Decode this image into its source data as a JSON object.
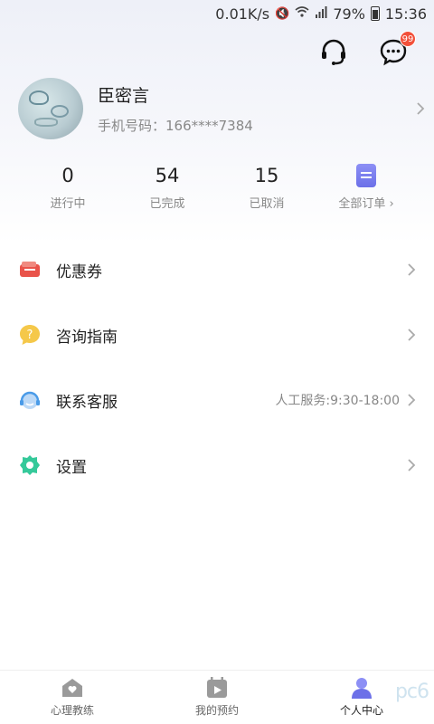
{
  "status_bar": {
    "speed": "0.01K/s",
    "battery": "79%",
    "time": "15:36"
  },
  "header": {
    "message_badge": "99"
  },
  "profile": {
    "name": "臣密言",
    "phone": "手机号码：166****7384"
  },
  "stats": [
    {
      "value": "0",
      "label": "进行中"
    },
    {
      "value": "54",
      "label": "已完成"
    },
    {
      "value": "15",
      "label": "已取消"
    },
    {
      "label": "全部订单 ›"
    }
  ],
  "menu": [
    {
      "label": "优惠券",
      "icon": "coupon-icon",
      "color": "#e9534a"
    },
    {
      "label": "咨询指南",
      "icon": "question-icon",
      "color": "#f5c84a"
    },
    {
      "label": "联系客服",
      "icon": "customer-service-icon",
      "extra": "人工服务:9:30-18:00",
      "color": "#4a9be8"
    },
    {
      "label": "设置",
      "icon": "gear-icon",
      "color": "#35c99a"
    }
  ],
  "tabbar": [
    {
      "label": "心理教练",
      "icon": "home-heart-icon"
    },
    {
      "label": "我的预约",
      "icon": "calendar-play-icon"
    },
    {
      "label": "个人中心",
      "icon": "person-icon",
      "active": true
    }
  ],
  "watermark": "pc6"
}
